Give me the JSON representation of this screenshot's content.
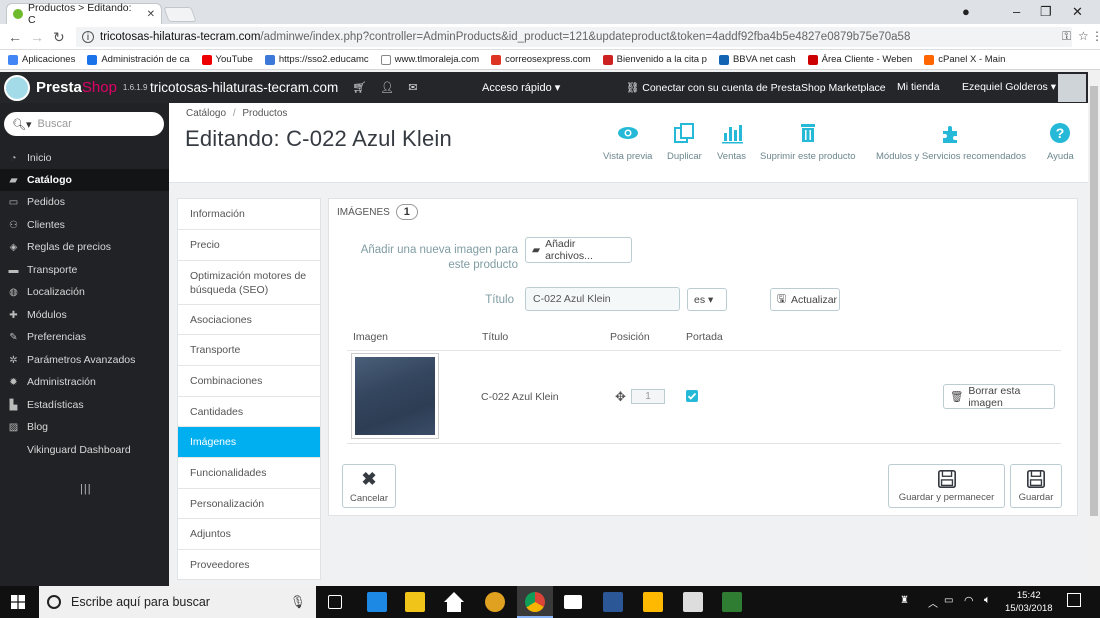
{
  "browser": {
    "tab_title": "Productos > Editando: C",
    "url_host": "tricotosas-hilaturas-tecram.com",
    "url_path": "/adminwe/index.php?controller=AdminProducts&id_product=121&updateproduct&token=4addf92fba4b5e4827e0879b75e70a58",
    "bookmarks": [
      "Aplicaciones",
      "Administración de ca",
      "YouTube",
      "https://sso2.educamc",
      "www.tlmoraleja.com",
      "correosexpress.com",
      "Bienvenido a la cita p",
      "BBVA net cash",
      "Área Cliente - Weben",
      "cPanel X - Main"
    ]
  },
  "header": {
    "logo_a": "Presta",
    "logo_b": "Shop",
    "version": "1.6.1.9",
    "shop_name": "tricotosas-hilaturas-tecram.com",
    "quick_access": "Acceso rápido ▾",
    "marketplace": "Conectar con su cuenta de PrestaShop Marketplace",
    "my_shop": "Mi tienda",
    "user": "Ezequiel Golderos ▾"
  },
  "sidebar": {
    "search_placeholder": "Buscar",
    "items": [
      {
        "label": "Inicio",
        "icon": "dashboard-icon"
      },
      {
        "label": "Catálogo",
        "icon": "book-icon"
      },
      {
        "label": "Pedidos",
        "icon": "credit-card-icon"
      },
      {
        "label": "Clientes",
        "icon": "users-icon"
      },
      {
        "label": "Reglas de precios",
        "icon": "tag-icon"
      },
      {
        "label": "Transporte",
        "icon": "truck-icon"
      },
      {
        "label": "Localización",
        "icon": "globe-icon"
      },
      {
        "label": "Módulos",
        "icon": "puzzle-icon"
      },
      {
        "label": "Preferencias",
        "icon": "wrench-icon"
      },
      {
        "label": "Parámetros Avanzados",
        "icon": "cogs-icon"
      },
      {
        "label": "Administración",
        "icon": "gear-icon"
      },
      {
        "label": "Estadísticas",
        "icon": "bar-chart-icon"
      },
      {
        "label": "Blog",
        "icon": "pencil-icon"
      },
      {
        "label": "Vikinguard Dashboard",
        "icon": ""
      }
    ]
  },
  "page": {
    "breadcrumb": [
      "Catálogo",
      "Productos"
    ],
    "title": "Editando: C-022 Azul Klein",
    "toolbar": [
      {
        "label": "Vista previa",
        "icon": "eye-icon"
      },
      {
        "label": "Duplicar",
        "icon": "copy-icon"
      },
      {
        "label": "Ventas",
        "icon": "bar-chart-icon"
      },
      {
        "label": "Suprimir este producto",
        "icon": "trash-icon"
      },
      {
        "label": "Módulos y Servicios recomendados",
        "icon": "puzzle-icon"
      },
      {
        "label": "Ayuda",
        "icon": "help-icon"
      }
    ]
  },
  "tabs": [
    "Información",
    "Precio",
    "Optimización motores de búsqueda (SEO)",
    "Asociaciones",
    "Transporte",
    "Combinaciones",
    "Cantidades",
    "Imágenes",
    "Funcionalidades",
    "Personalización",
    "Adjuntos",
    "Proveedores"
  ],
  "images_panel": {
    "heading": "IMÁGENES",
    "count": "1",
    "add_label": "Añadir una nueva imagen para este producto",
    "add_button": "Añadir archivos...",
    "title_label": "Título",
    "title_value": "C-022 Azul Klein",
    "lang": "es ▾",
    "update_button": "Actualizar",
    "columns": [
      "Imagen",
      "Título",
      "Posición",
      "Portada"
    ],
    "row": {
      "title": "C-022 Azul Klein",
      "position": "1"
    },
    "delete_button": "Borrar esta imagen"
  },
  "footer_actions": {
    "cancel": "Cancelar",
    "save_stay": "Guardar y permanecer",
    "save": "Guardar"
  },
  "taskbar": {
    "search": "Escribe aquí para buscar",
    "time": "15:42",
    "date": "15/03/2018"
  },
  "colors": {
    "accent": "#00aff0",
    "sidebar": "#202226",
    "header": "#25262a",
    "brand": "#df0067"
  }
}
